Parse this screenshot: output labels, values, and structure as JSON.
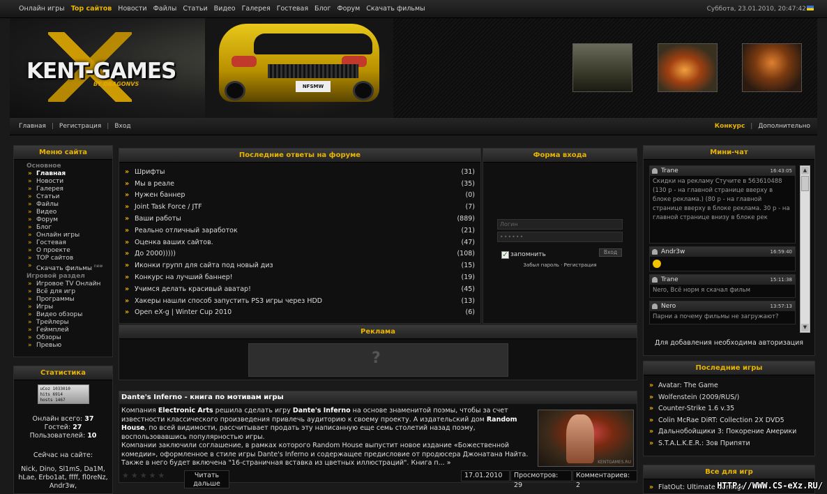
{
  "topnav": [
    "Онлайн игры",
    "Top сайтов",
    "Новости",
    "Файлы",
    "Статьи",
    "Видео",
    "Галерея",
    "Гостевая",
    "Блог",
    "Форум",
    "Скачать фильмы"
  ],
  "datetime": "Суббота, 23.01.2010, 20:47:42",
  "logo": {
    "title": "KENT-GAMES",
    "sub": "BY DRAGONVS"
  },
  "car_plate": "NFSMW",
  "subnav_left": [
    "Главная",
    "Регистрация",
    "Вход"
  ],
  "subnav_right": [
    "Конкурс",
    "Дополнительно"
  ],
  "menu": {
    "title": "Меню сайта",
    "sec1": "Основное",
    "items1": [
      "Главная",
      "Новости",
      "Галерея",
      "Статьи",
      "Файлы",
      "Видео",
      "Форум",
      "Блог",
      "Онлайн игры",
      "Гостевая",
      "О проекте",
      "TOP сайтов",
      "Скачать фильмы"
    ],
    "new_badge": "new",
    "sec2": "Игровой раздел",
    "items2": [
      "Игровое TV Онлайн",
      "Всё для игр",
      "Программы",
      "Игры",
      "Видео обзоры",
      "Трейлеры",
      "Геймплей",
      "Обзоры",
      "Превью"
    ]
  },
  "stats": {
    "title": "Статистика",
    "counter": [
      "uCoz 1033010",
      "hits 6914",
      "hosts 1467"
    ],
    "online_label": "Онлайн всего:",
    "online": "37",
    "guests_label": "Гостей:",
    "guests": "27",
    "users_label": "Пользователей:",
    "users": "10",
    "now_label": "Сейчас на сайте:",
    "names": "Nick, Dino, Sl1mS, Da1M, hLae, Erbo1at, ffff, fl0reNz, Andr3w,"
  },
  "forum": {
    "title": "Последние ответы на форуме",
    "rows": [
      {
        "t": "Шрифты",
        "c": "(31)"
      },
      {
        "t": "Мы в реале",
        "c": "(35)"
      },
      {
        "t": "Нужен баннер",
        "c": "(0)"
      },
      {
        "t": "Joint Task Force / JTF",
        "c": "(7)"
      },
      {
        "t": "Ваши работы",
        "c": "(889)"
      },
      {
        "t": "Реально отличный заработок",
        "c": "(21)"
      },
      {
        "t": "Оценка ваших сайтов.",
        "c": "(47)"
      },
      {
        "t": "До 2000)))))",
        "c": "(108)"
      },
      {
        "t": "Иконки групп для сайта под новый диз",
        "c": "(15)"
      },
      {
        "t": "Конкурс на лучший баннер!",
        "c": "(19)"
      },
      {
        "t": "Учимся делать красивый аватар!",
        "c": "(45)"
      },
      {
        "t": "Хакеры нашли способ запустить PS3 игры через HDD",
        "c": "(13)"
      },
      {
        "t": "Open eX-g | Winter Cup 2010",
        "c": "(6)"
      }
    ]
  },
  "login": {
    "title": "Форма входа",
    "login_ph": "Логин",
    "pass": "••••••",
    "remember": "запомнить",
    "btn": "Вход",
    "links": "Забыл пароль · Регистрация"
  },
  "ads": {
    "title": "Реклама"
  },
  "news": {
    "title": "Dante's Inferno - книга по мотивам игры",
    "p1a": "Компания ",
    "p1b": "Electronic Arts",
    "p1c": " решила сделать игру ",
    "p1d": "Dante's Inferno",
    "p1e": " на основе знаменитой поэмы, чтобы за счет известности классического произведения привлечь аудиторию к своему проекту. А издательский дом ",
    "p1f": "Random House",
    "p1g": ", по всей видимости, рассчитывает продать эту написанную еще семь столетий назад поэму, воспользовавшись популярностью игры.",
    "p2": "Компании заключили соглашение, в рамках которого Random House выпустит новое издание «Божественной комедии», оформленное в стиле игры Dante's Inferno и содержащее предисловие от продюсера Джонатана Найта. Также в него будет включена \"16-страничная вставка из цветных иллюстраций\". Книга п... »",
    "read": "Читать дальше",
    "date": "17.01.2010",
    "views": "Просмотров: 29",
    "comments": "Комментариев: 2",
    "img_caption": "KENTGAMES.RU"
  },
  "chat": {
    "title": "Мини-чат",
    "msgs": [
      {
        "u": "Trane",
        "t": "16:43:05",
        "m": "Скидки на рекламу Стучите в 563610488 (130 р - на главной странице вверху в блоке реклама.) (80 р - на главной странице вверху в блоке реклама. 30 р - на главной странице внизу в блоке рек"
      },
      {
        "u": "Andr3w",
        "t": "16:59:40",
        "m": ""
      },
      {
        "u": "Trane",
        "t": "15:11:38",
        "m": "Nero, Всё норм я скачал фильм"
      },
      {
        "u": "Nero",
        "t": "13:57:13",
        "m": "Парни а почему фильмы не загружают?"
      }
    ],
    "note": "Для добавления необходима авторизация"
  },
  "lastgames": {
    "title": "Последние игры",
    "items": [
      "Avatar: The Game",
      "Wolfenstein (2009/RUS/)",
      "Counter-Strike 1.6 v.35",
      "Colin McRae DiRT: Collection 2X DVD5",
      "Дальнобойщики 3: Покорение Америки",
      "S.T.A.L.K.E.R.: Зов Припяти"
    ]
  },
  "allgames": {
    "title": "Все для игр",
    "first": "FlatOut: Ultimate Carnage"
  },
  "watermark": "HTTP://WWW.CS-eXz.RU/"
}
